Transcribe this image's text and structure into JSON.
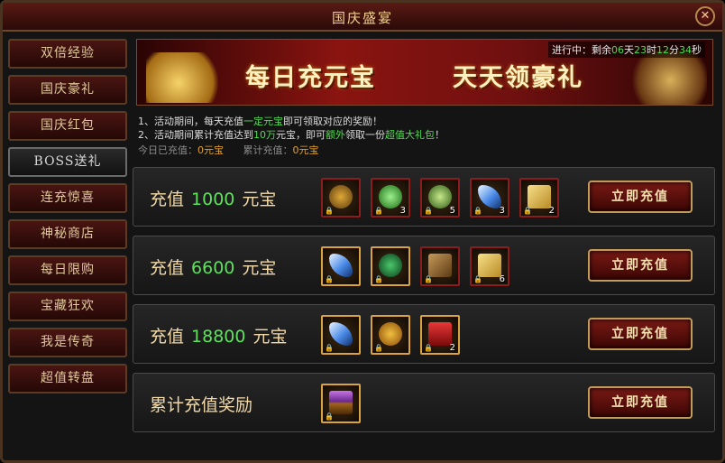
{
  "window": {
    "title": "国庆盛宴",
    "close_icon": "✕"
  },
  "sidebar": {
    "items": [
      {
        "label": "双倍经验"
      },
      {
        "label": "国庆豪礼"
      },
      {
        "label": "国庆红包"
      },
      {
        "label": "BOSS送礼"
      },
      {
        "label": "连充惊喜"
      },
      {
        "label": "神秘商店"
      },
      {
        "label": "每日限购"
      },
      {
        "label": "宝藏狂欢"
      },
      {
        "label": "我是传奇"
      },
      {
        "label": "超值转盘"
      }
    ],
    "active_index": 3
  },
  "banner": {
    "slogan_left": "每日充元宝",
    "slogan_right": "天天领豪礼",
    "countdown": {
      "prefix": "进行中：剩余",
      "days": "06",
      "d_unit": "天",
      "hours": "23",
      "h_unit": "时",
      "minutes": "12",
      "m_unit": "分",
      "seconds": "34",
      "s_unit": "秒"
    }
  },
  "rules": {
    "line1": {
      "a": "1、活动期间，每天充值",
      "b": "一定元宝",
      "c": "即可领取对应的奖励！"
    },
    "line2": {
      "a": "2、活动期间累计充值达到",
      "b": "10万",
      "c": "元宝，即可",
      "d": "额外",
      "e": "领取一份",
      "f": "超值大礼包",
      "g": "！"
    },
    "today_label": "今日已充值：",
    "today_value": "0元宝",
    "total_label": "累计充值：",
    "total_value": "0元宝"
  },
  "tiers": [
    {
      "prefix": "充值",
      "amount": "1000",
      "suffix": "元宝",
      "button": "立即充值",
      "items": [
        {
          "icon": "gold-sack-icon",
          "count": ""
        },
        {
          "icon": "green-orb-icon",
          "count": "3"
        },
        {
          "icon": "green-gem-icon",
          "count": "5"
        },
        {
          "icon": "blue-wing-icon",
          "count": "3"
        },
        {
          "icon": "gold-scroll-icon",
          "count": "2"
        }
      ]
    },
    {
      "prefix": "充值",
      "amount": "6600",
      "suffix": "元宝",
      "button": "立即充值",
      "items": [
        {
          "icon": "blue-wing-icon",
          "count": ""
        },
        {
          "icon": "jade-orb-icon",
          "count": ""
        },
        {
          "icon": "skill-book-icon",
          "count": ""
        },
        {
          "icon": "gold-scroll-icon",
          "count": "6"
        }
      ]
    },
    {
      "prefix": "充值",
      "amount": "18800",
      "suffix": "元宝",
      "button": "立即充值",
      "items": [
        {
          "icon": "blue-wing-icon",
          "count": ""
        },
        {
          "icon": "gold-orb-icon",
          "count": ""
        },
        {
          "icon": "red-envelope-icon",
          "count": "2"
        }
      ]
    },
    {
      "prefix": "累计充值奖励",
      "amount": "",
      "suffix": "",
      "button": "立即充值",
      "items": [
        {
          "icon": "treasure-chest-icon",
          "count": ""
        }
      ]
    }
  ],
  "colors": {
    "accent_green": "#4fdc4f",
    "gold_text": "#f2d9a8",
    "button_red": "#7a1a14",
    "border_gold": "#c29a5a"
  }
}
